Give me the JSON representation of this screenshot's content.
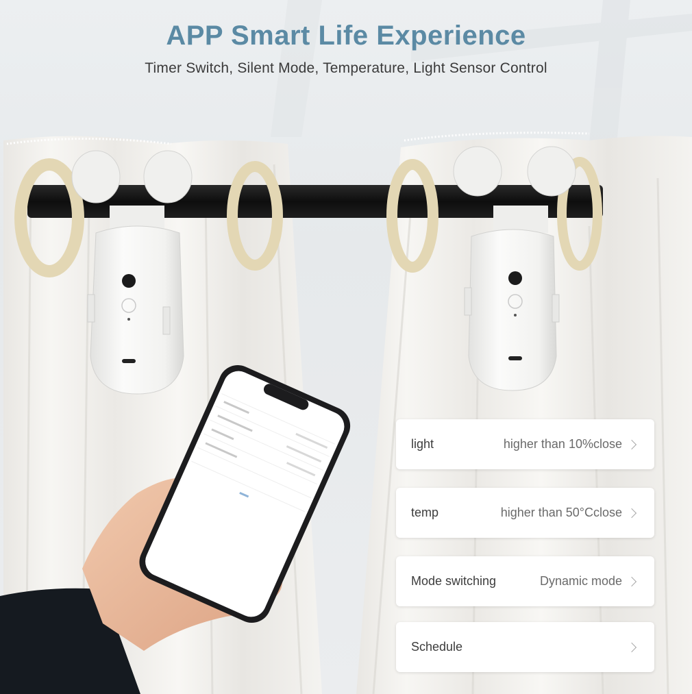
{
  "header": {
    "title": "APP Smart Life Experience",
    "subtitle": "Timer Switch, Silent Mode, Temperature, Light Sensor Control"
  },
  "settings": [
    {
      "label": "light",
      "value": "higher than 10%close"
    },
    {
      "label": "temp",
      "value": "higher than 50°Cclose"
    },
    {
      "label": "Mode switching",
      "value": "Dynamic mode"
    },
    {
      "label": "Schedule",
      "value": ""
    }
  ],
  "colors": {
    "title": "#5b8aa4",
    "rod": "#141414",
    "ring": "#e3d7b4",
    "curtain": "#f4f2ee",
    "card": "#ffffff"
  },
  "icons": [
    "chevron-right-icon"
  ]
}
